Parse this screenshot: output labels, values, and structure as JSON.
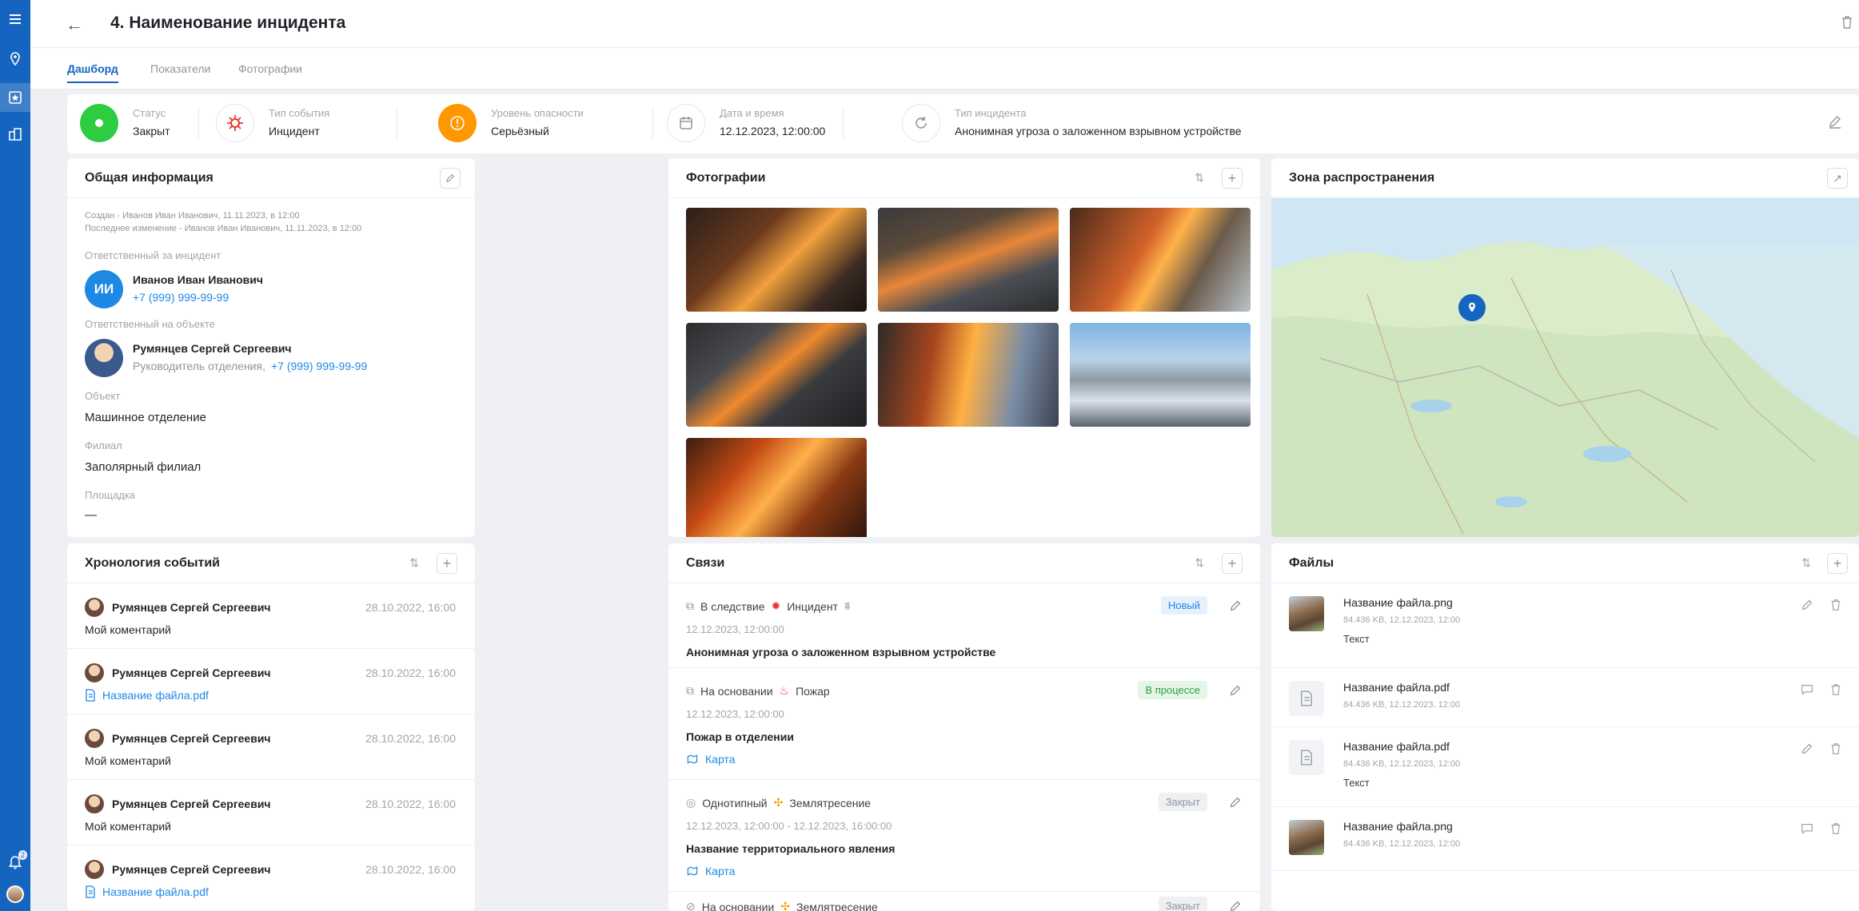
{
  "header": {
    "title": "4. Наименование инцидента",
    "back_icon": "arrow-left-icon",
    "trash_icon": "trash-icon"
  },
  "nav_rail": {
    "items": [
      "menu-icon",
      "location-pin-icon",
      "star-doc-icon",
      "building-icon"
    ],
    "notifications_count": "2"
  },
  "tabs": [
    {
      "label": "Дашборд",
      "active": true
    },
    {
      "label": "Показатели",
      "active": false
    },
    {
      "label": "Фотографии",
      "active": false
    }
  ],
  "status_strip": {
    "status": {
      "label": "Статус",
      "value": "Закрыт",
      "color": "#2ecc40"
    },
    "event_type": {
      "label": "Тип события",
      "value": "Инцидент",
      "color": "#e53935"
    },
    "danger_level": {
      "label": "Уровень опасности",
      "value": "Серьёзный",
      "color": "#ff9800"
    },
    "datetime": {
      "label": "Дата и время",
      "value": "12.12.2023, 12:00:00"
    },
    "incident_type": {
      "label": "Тип инцидента",
      "value": "Анонимная угроза о заложенном взрывном устройстве"
    }
  },
  "general_info": {
    "title": "Общая информация",
    "created": "Создан - Иванов Иван Иванович, 11.11.2023, в 12:00",
    "modified": "Последнее изменение - Иванов Иван Иванович, 11.11.2023, в 12:00",
    "responsible_label": "Ответственный за инцидент",
    "responsible_initials": "ИИ",
    "responsible_name": "Иванов Иван Иванович",
    "responsible_phone": "+7 (999) 999-99-99",
    "object_responsible_label": "Ответственный на объекте",
    "object_responsible_name": "Румянцев Сергей Сергеевич",
    "object_responsible_role": "Руководитель отделения,",
    "object_responsible_phone": "+7 (999) 999-99-99",
    "object_label": "Объект",
    "object_value": "Машинное отделение",
    "branch_label": "Филиал",
    "branch_value": "Заполярный филиал",
    "site_label": "Площадка",
    "site_value": "—"
  },
  "photos": {
    "title": "Фотографии",
    "count": 7
  },
  "zone": {
    "title": "Зона распространения"
  },
  "timeline": {
    "title": "Хронология событий",
    "items": [
      {
        "name": "Румянцев Сергей Сергеевич",
        "date": "28.10.2022, 16:00",
        "text": "Мой коментарий",
        "type": "comment"
      },
      {
        "name": "Румянцев Сергей Сергеевич",
        "date": "28.10.2022, 16:00",
        "text": "Название файла.pdf",
        "type": "file"
      },
      {
        "name": "Румянцев Сергей Сергеевич",
        "date": "28.10.2022, 16:00",
        "text": "Мой коментарий",
        "type": "comment"
      },
      {
        "name": "Румянцев Сергей Сергеевич",
        "date": "28.10.2022, 16:00",
        "text": "Мой коментарий",
        "type": "comment"
      },
      {
        "name": "Румянцев Сергей Сергеевич",
        "date": "28.10.2022, 16:00",
        "text": "Название файла.pdf",
        "type": "file"
      }
    ]
  },
  "links": {
    "title": "Связи",
    "items": [
      {
        "relation": "В следствие",
        "kind": "Инцидент",
        "badge": "Новый",
        "badge_color": "#1e88e5",
        "date": "12.12.2023, 12:00:00",
        "title": "Анонимная угроза о заложенном взрывном устройстве",
        "map": ""
      },
      {
        "relation": "На основании",
        "kind": "Пожар",
        "badge": "В процессе",
        "badge_color": "#2e9e44",
        "date": "12.12.2023, 12:00:00",
        "title": "Пожар в отделении",
        "map": "Карта"
      },
      {
        "relation": "Однотипный",
        "kind": "Землятресение",
        "badge": "Закрыт",
        "badge_color": "#8f959e",
        "date": "12.12.2023, 12:00:00 - 12.12.2023, 16:00:00",
        "title": "Название территориального явления",
        "map": "Карта"
      },
      {
        "relation": "На основании",
        "kind": "Землятресение",
        "badge": "Закрыт",
        "badge_color": "#8f959e",
        "date": "",
        "title": "",
        "map": ""
      }
    ]
  },
  "files": {
    "title": "Файлы",
    "items": [
      {
        "name": "Название файла.png",
        "meta": "84.436 KB, 12.12.2023, 12:00",
        "text": "Текст",
        "thumb": "image"
      },
      {
        "name": "Название файла.pdf",
        "meta": "84.436 KB, 12.12.2023, 12:00",
        "text": "",
        "thumb": "doc"
      },
      {
        "name": "Название файла.pdf",
        "meta": "84.436 KB, 12.12.2023, 12:00",
        "text": "Текст",
        "thumb": "doc"
      },
      {
        "name": "Название файла.png",
        "meta": "84.436 KB, 12.12.2023, 12:00",
        "text": "",
        "thumb": "image"
      }
    ]
  },
  "colors": {
    "accent": "#1565c0",
    "link": "#1e88e5"
  }
}
